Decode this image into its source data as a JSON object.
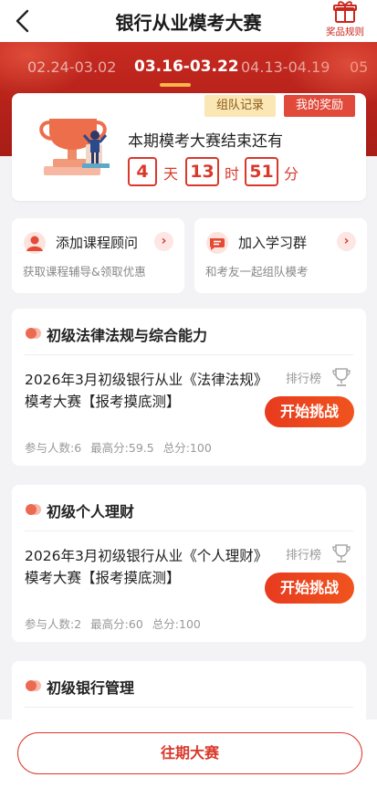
{
  "header": {
    "title": "银行从业模考大赛",
    "rules_label": "奖品规则"
  },
  "tabs": [
    {
      "label": "02.24-03.02",
      "active": false
    },
    {
      "label": "03.16-03.22",
      "active": true
    },
    {
      "label": "04.13-04.19",
      "active": false
    },
    {
      "label": "05",
      "active": false
    }
  ],
  "countdown_card": {
    "team_record_label": "组队记录",
    "my_reward_label": "我的奖励",
    "text": "本期模考大赛结束还有",
    "days": "4",
    "days_unit": "天",
    "hours": "13",
    "hours_unit": "时",
    "minutes": "51",
    "minutes_unit": "分"
  },
  "services": [
    {
      "name": "添加课程顾问",
      "desc": "获取课程辅导&领取优惠",
      "arrow": "›"
    },
    {
      "name": "加入学习群",
      "desc": "和考友一起组队模考",
      "arrow": "›"
    }
  ],
  "exams": [
    {
      "category": "初级法律法规与综合能力",
      "title": "2026年3月初级银行从业《法律法规》模考大赛【报考摸底测】",
      "rank_label": "排行榜",
      "button_label": "开始挑战",
      "participants": "参与人数:6",
      "max_score": "最高分:59.5",
      "total": "总分:100"
    },
    {
      "category": "初级个人理财",
      "title": "2026年3月初级银行从业《个人理财》模考大赛【报考摸底测】",
      "rank_label": "排行榜",
      "button_label": "开始挑战",
      "participants": "参与人数:2",
      "max_score": "最高分:60",
      "total": "总分:100"
    },
    {
      "category": "初级银行管理"
    }
  ],
  "bottom": {
    "past_button_label": "往期大赛"
  },
  "colors": {
    "brand_red": "#d9392b",
    "banner_red": "#c72a20",
    "button_orange": "#f0541e"
  },
  "icons": [
    "back-icon",
    "gift-icon",
    "trophy-icon",
    "advisor-icon",
    "chat-group-icon",
    "arrow-right-icon",
    "category-dot-icon",
    "leaderboard-icon"
  ]
}
